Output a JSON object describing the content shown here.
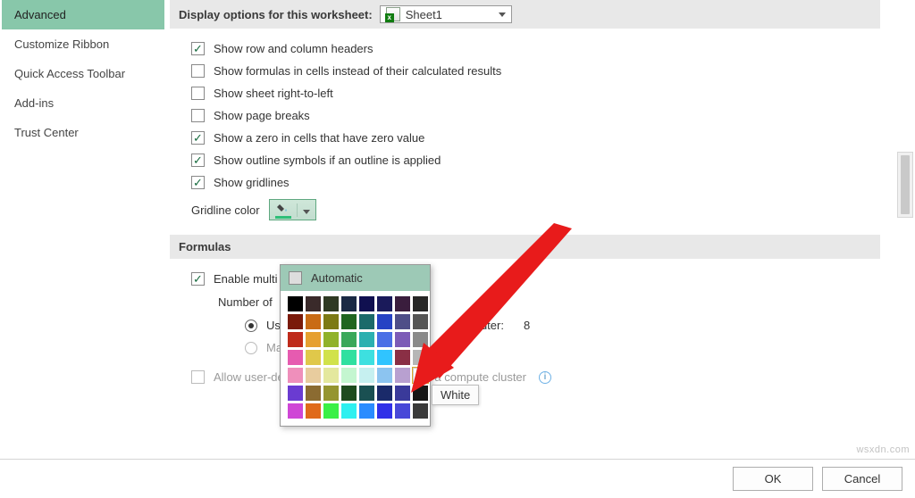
{
  "sidebar": {
    "items": [
      {
        "label": "Advanced",
        "selected": true
      },
      {
        "label": "Customize Ribbon"
      },
      {
        "label": "Quick Access Toolbar"
      },
      {
        "label": "Add-ins"
      },
      {
        "label": "Trust Center"
      }
    ]
  },
  "sections": {
    "display": {
      "header": "Display options for this worksheet:",
      "sheet_selected": "Sheet1",
      "options": [
        {
          "key": "row_col_headers",
          "label": "Show row and column headers",
          "checked": true
        },
        {
          "key": "show_formulas",
          "label": "Show formulas in cells instead of their calculated results",
          "checked": false
        },
        {
          "key": "rtl",
          "label": "Show sheet right-to-left",
          "checked": false
        },
        {
          "key": "page_breaks",
          "label": "Show page breaks",
          "checked": false
        },
        {
          "key": "zero_value",
          "label": "Show a zero in cells that have zero value",
          "checked": true
        },
        {
          "key": "outline",
          "label": "Show outline symbols if an outline is applied",
          "checked": true
        },
        {
          "key": "gridlines",
          "label": "Show gridlines",
          "checked": true
        }
      ],
      "gridline_color_label": "Gridline color"
    },
    "formulas": {
      "header": "Formulas",
      "multi_label": "Enable multi",
      "multi_checked": true,
      "number_label": "Number of",
      "radio_use": "Us",
      "radio_manual": "Ma",
      "use_selected": true,
      "processors_suffix": "mputer:",
      "processors_value": "8",
      "allow_xll": "Allow user-defined XLL functions to run on a compute cluster",
      "allow_xll_checked": false
    }
  },
  "color_picker": {
    "automatic_label": "Automatic",
    "highlighted_tooltip": "White",
    "palette": [
      [
        "#000000",
        "#3a2a2a",
        "#2f3a23",
        "#1a2a44",
        "#101050",
        "#1a1a5a",
        "#3a1d3d",
        "#262626"
      ],
      [
        "#7a1a0a",
        "#c96b15",
        "#7c7a15",
        "#206620",
        "#1c6a6a",
        "#2642c4",
        "#4e4e88",
        "#555555"
      ],
      [
        "#bf2a1a",
        "#e6a030",
        "#90b22a",
        "#3aa85a",
        "#2bb0b0",
        "#4a6fe6",
        "#7c5bb7",
        "#8a8a8a"
      ],
      [
        "#e65bb0",
        "#e0c84a",
        "#d1e24a",
        "#30e0a0",
        "#3de0e0",
        "#30c4ff",
        "#8a2f45",
        "#b6b6b6"
      ],
      [
        "#ef8fbb",
        "#e8cc9e",
        "#e4e89e",
        "#c4f6d0",
        "#c6f0f0",
        "#8cc4f0",
        "#b8a0d0",
        "#ffffff"
      ],
      [
        "#6a3bd1",
        "#8b6b31",
        "#959530",
        "#1e4b1e",
        "#1a5052",
        "#1a2a6a",
        "#3a3a9a",
        "#161616"
      ],
      [
        "#cf46d6",
        "#e06a1a",
        "#3af046",
        "#2ef0f0",
        "#2a8cff",
        "#3030e8",
        "#4848d8",
        "#3a3a3a"
      ]
    ]
  },
  "buttons": {
    "ok": "OK",
    "cancel": "Cancel"
  },
  "watermark": "wsxdn.com"
}
